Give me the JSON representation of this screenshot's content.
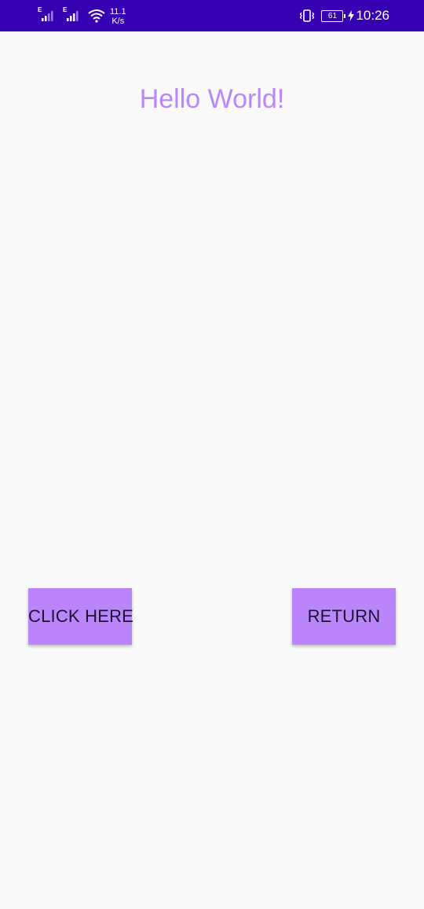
{
  "status_bar": {
    "signal1_type": "E",
    "signal2_type": "E",
    "net_speed_value": "11.1",
    "net_speed_unit": "K/s",
    "battery_level": "61",
    "time": "10:26",
    "bg_color": "#3700b3"
  },
  "main": {
    "greeting": "Hello World!",
    "greeting_color": "#bb86fc"
  },
  "buttons": {
    "click_here_label": "CLICK HERE",
    "return_label": "RETURN",
    "button_color": "#bb86fc"
  }
}
